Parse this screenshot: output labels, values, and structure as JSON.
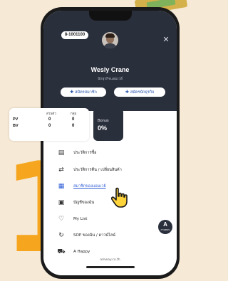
{
  "promo": {
    "big_number": "1"
  },
  "profile": {
    "code": "8-1001100",
    "name": "Wesly Crane",
    "subtitle": "นักธุรกิจแอมเวย์",
    "buttons": [
      {
        "label": "สมัครสมาชิก",
        "icon": "person-add-icon"
      },
      {
        "label": "สมัครนักธุรกิจ",
        "icon": "person-add-icon"
      }
    ]
  },
  "stats": {
    "col_headers": [
      "ส่วนตัว",
      "กลุ่ม"
    ],
    "rows": [
      {
        "label": "PV",
        "values": [
          "0",
          "0"
        ]
      },
      {
        "label": "BV",
        "values": [
          "0",
          "0"
        ]
      }
    ],
    "bonus_label": "Bonus",
    "bonus_value": "0%"
  },
  "menu": [
    {
      "label": "ประวัติการซื้อ",
      "icon": "receipt-icon",
      "active": false
    },
    {
      "label": "ประวัติการคืน / เปลี่ยนสินค้า",
      "icon": "exchange-icon",
      "active": false
    },
    {
      "label": "สมาชิกของแอมเวย์",
      "icon": "members-icon",
      "active": true
    },
    {
      "label": "บัญชีของฉัน",
      "icon": "account-icon",
      "active": false
    },
    {
      "label": "My List",
      "icon": "list-icon",
      "active": false
    },
    {
      "label": "SOP ของฉัน / ดาวน์ไลน์",
      "icon": "sop-icon",
      "active": false
    },
    {
      "label": "A Happy",
      "icon": "cart-icon",
      "active": false
    }
  ],
  "footer": {
    "url": "amway.co.th"
  },
  "fab": {
    "label": "A",
    "sub": "ถามตอบ"
  }
}
